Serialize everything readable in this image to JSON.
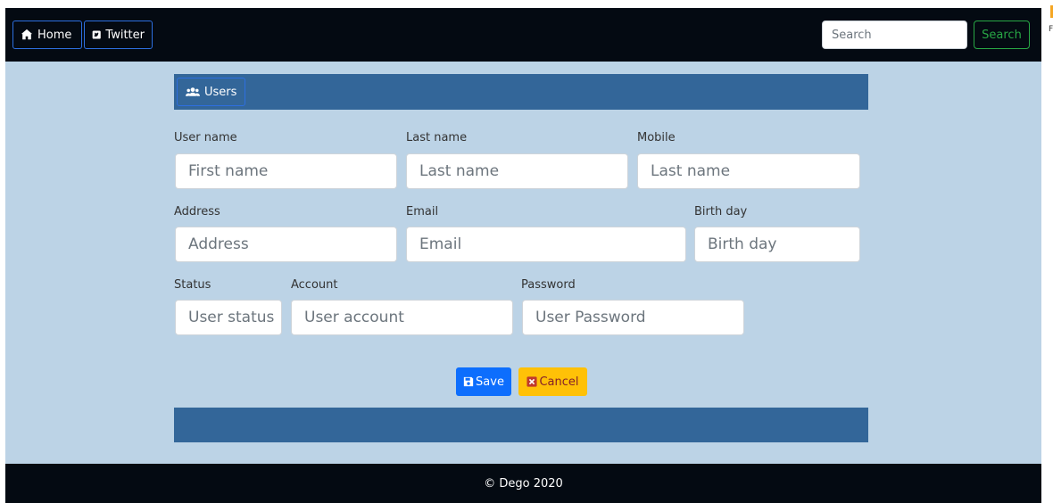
{
  "nav": {
    "home_label": "Home",
    "twitter_label": "Twitter",
    "search_placeholder": "Search",
    "search_button": "Search"
  },
  "card": {
    "users_tab": "Users"
  },
  "form": {
    "username_label": "User name",
    "username_placeholder": "First name",
    "lastname_label": "Last name",
    "lastname_placeholder": "Last name",
    "mobile_label": "Mobile",
    "mobile_placeholder": "Last name",
    "address_label": "Address",
    "address_placeholder": "Address",
    "email_label": "Email",
    "email_placeholder": "Email",
    "birthday_label": "Birth day",
    "birthday_placeholder": "Birth day",
    "status_label": "Status",
    "status_placeholder": "User status",
    "account_label": "Account",
    "account_placeholder": "User account",
    "password_label": "Password",
    "password_placeholder": "User Password"
  },
  "actions": {
    "save_label": "Save",
    "cancel_label": "Cancel"
  },
  "footer": {
    "copyright": "© Dego 2020"
  },
  "edge": {
    "right_glyph": "F"
  },
  "colors": {
    "navbar": "#040a12",
    "page_bg": "#bcd3e6",
    "card_header": "#336699",
    "save": "#0d6efd",
    "cancel": "#ffc107",
    "search_outline": "#28a745"
  }
}
